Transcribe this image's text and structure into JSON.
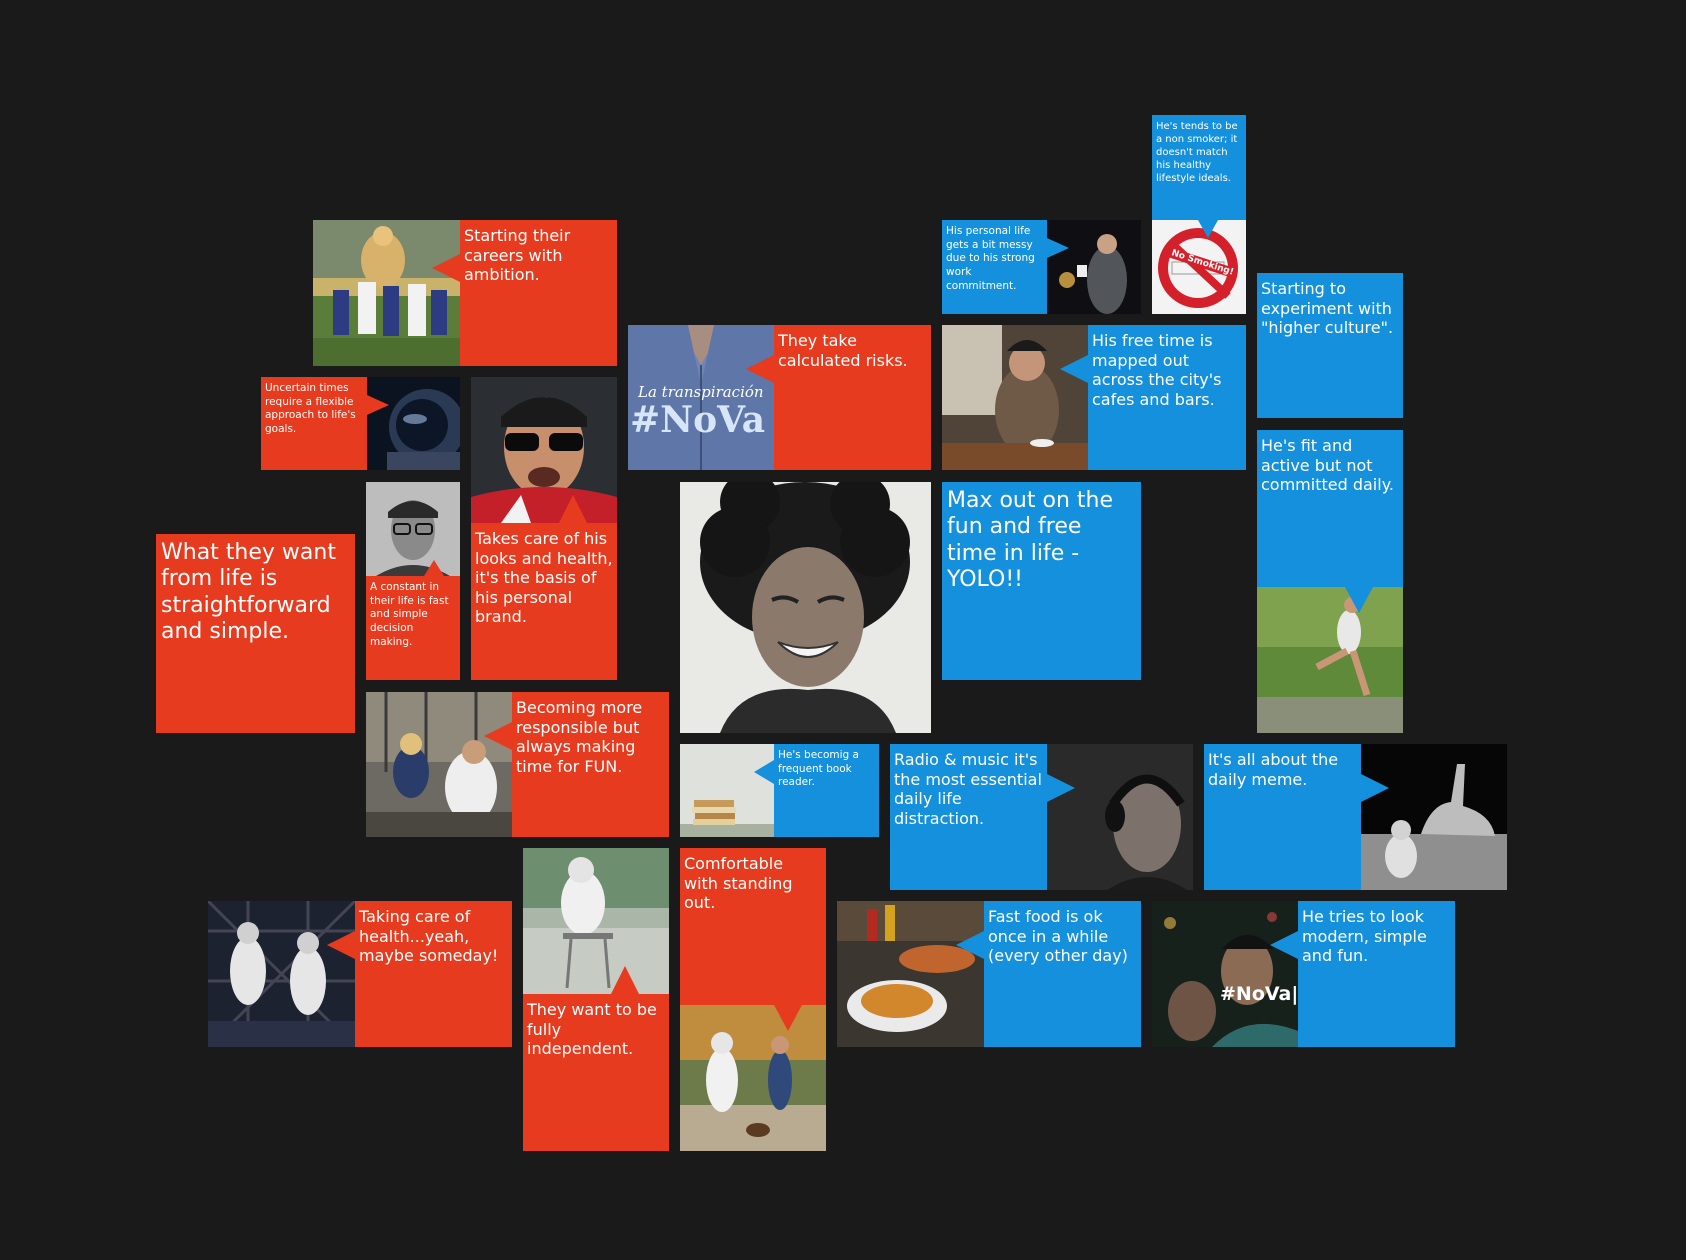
{
  "tiles": {
    "starting_careers": "Starting their careers with ambition.",
    "uncertain_times": "Uncertain times require a flexible approach to life's goals.",
    "looks_health": "Takes care of his looks and health, it's the basis of his personal brand.",
    "constant_in_life": "A constant in their life is fast and simple decision making.",
    "what_they_want": "What they want from life is straightforward and simple.",
    "calculated_risks": "They take calculated risks.",
    "becoming_responsible": "Becoming more responsible but always making time for FUN.",
    "book_reader": "He's becomig a frequent book reader.",
    "taking_care_health": "Taking care of health...yeah, maybe someday!",
    "fully_independent": "They want to be fully independent.",
    "standing_out": "Comfortable with standing out.",
    "personal_life_messy": "His personal life gets a bit messy due to his strong work commitment.",
    "non_smoker": "He's tends to be a non smoker; it doesn't match his healthy lifestyle ideals.",
    "free_time_cafes": "His free time is mapped out across the city's cafes and bars.",
    "higher_culture": "Starting to experiment with \"higher culture\".",
    "max_out_fun": "Max out on the fun and free time in life - YOLO!!",
    "fit_active": "He's fit and active but not committed daily.",
    "radio_music": "Radio & music it's the most essential daily life distraction.",
    "daily_meme": "It's all about the daily meme.",
    "fast_food": "Fast food is ok once in a while (every other day)",
    "modern_simple": "He tries to look modern, simple and fun."
  },
  "photo_captions": {
    "nova_shirt_script": "La transpiración",
    "nova_shirt_tag": "#NoVa",
    "nova_couple_tag": "#NoVa|",
    "no_smoking_sign": "No Smoking!"
  },
  "colors": {
    "background": "#1b1a1b",
    "red_tile": "#e63b1e",
    "blue_tile": "#1590dd"
  }
}
